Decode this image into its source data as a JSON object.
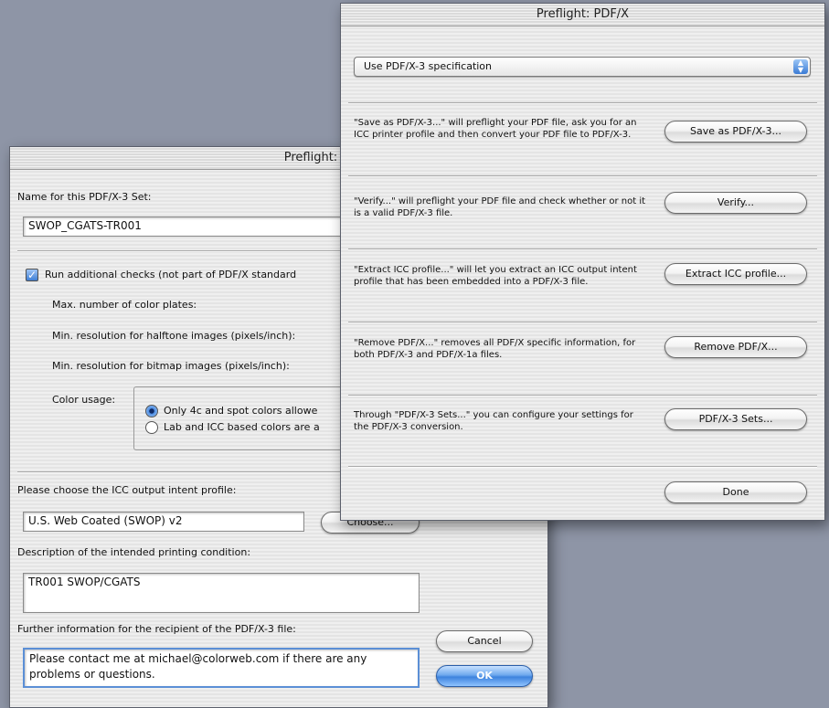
{
  "create_dialog": {
    "title": "Preflight: Create PDF/X",
    "name_label": "Name for this PDF/X-3 Set:",
    "name_value": "SWOP_CGATS-TR001",
    "run_checks_label": "Run additional checks (not part of PDF/X standard",
    "max_plates_label": "Max. number of color plates:",
    "min_halftone_label": "Min. resolution for halftone images (pixels/inch):",
    "min_bitmap_label": "Min. resolution for bitmap images (pixels/inch):",
    "color_usage_label": "Color usage:",
    "color_option_1": "Only 4c and spot colors allowe",
    "color_option_2": "Lab and ICC based colors are a",
    "icc_label": "Please choose the ICC output intent profile:",
    "icc_value": "U.S. Web Coated (SWOP) v2",
    "choose_button": "Choose...",
    "description_label": "Description of the intended printing condition:",
    "description_value": "TR001 SWOP/CGATS",
    "further_label": "Further information for the recipient of the PDF/X-3 file:",
    "further_value": "Please contact me at michael@colorweb.com if there are any problems or questions.",
    "cancel_button": "Cancel",
    "ok_button": "OK"
  },
  "pdfx_dialog": {
    "title": "Preflight: PDF/X",
    "spec_selected": "Use PDF/X-3 specification",
    "rows": [
      {
        "desc": "\"Save as PDF/X-3...\" will preflight your PDF file, ask you for an ICC printer profile and then convert your PDF file to PDF/X-3.",
        "button": "Save as PDF/X-3..."
      },
      {
        "desc": "\"Verify...\" will preflight your PDF file and check whether or not it is a valid PDF/X-3 file.",
        "button": "Verify..."
      },
      {
        "desc": "\"Extract ICC profile...\" will let you extract an ICC output intent profile that has been embedded into a PDF/X-3 file.",
        "button": "Extract ICC profile..."
      },
      {
        "desc": "\"Remove PDF/X...\" removes all PDF/X specific information, for both PDF/X-3 and PDF/X-1a files.",
        "button": "Remove PDF/X..."
      },
      {
        "desc": "Through \"PDF/X-3 Sets...\" you can configure your settings for the PDF/X-3 conversion.",
        "button": "PDF/X-3 Sets..."
      }
    ],
    "done_button": "Done"
  }
}
